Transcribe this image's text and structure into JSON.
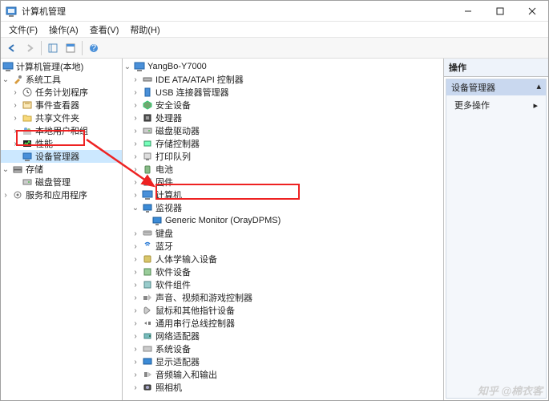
{
  "window": {
    "title": "计算机管理"
  },
  "menu": {
    "file": "文件(F)",
    "action": "操作(A)",
    "view": "查看(V)",
    "help": "帮助(H)"
  },
  "left_tree": {
    "root": "计算机管理(本地)",
    "sysTools": "系统工具",
    "items": {
      "task": "任务计划程序",
      "event": "事件查看器",
      "shared": "共享文件夹",
      "users": "本地用户和组",
      "perf": "性能",
      "devmgr": "设备管理器"
    },
    "storage": "存储",
    "disk": "磁盘管理",
    "services": "服务和应用程序"
  },
  "device_tree": {
    "root": "YangBo-Y7000",
    "items": [
      "IDE ATA/ATAPI 控制器",
      "USB 连接器管理器",
      "安全设备",
      "处理器",
      "磁盘驱动器",
      "存储控制器",
      "打印队列",
      "电池",
      "固件",
      "计算机",
      "监视器",
      "键盘",
      "蓝牙",
      "人体学输入设备",
      "软件设备",
      "软件组件",
      "声音、视频和游戏控制器",
      "鼠标和其他指针设备",
      "通用串行总线控制器",
      "网络适配器",
      "系统设备",
      "显示适配器",
      "音频输入和输出",
      "照相机"
    ],
    "monitor_child": "Generic Monitor (OrayDPMS)"
  },
  "actions": {
    "header": "操作",
    "section": "设备管理器",
    "more": "更多操作"
  },
  "watermark": "知乎 @棉衣客"
}
